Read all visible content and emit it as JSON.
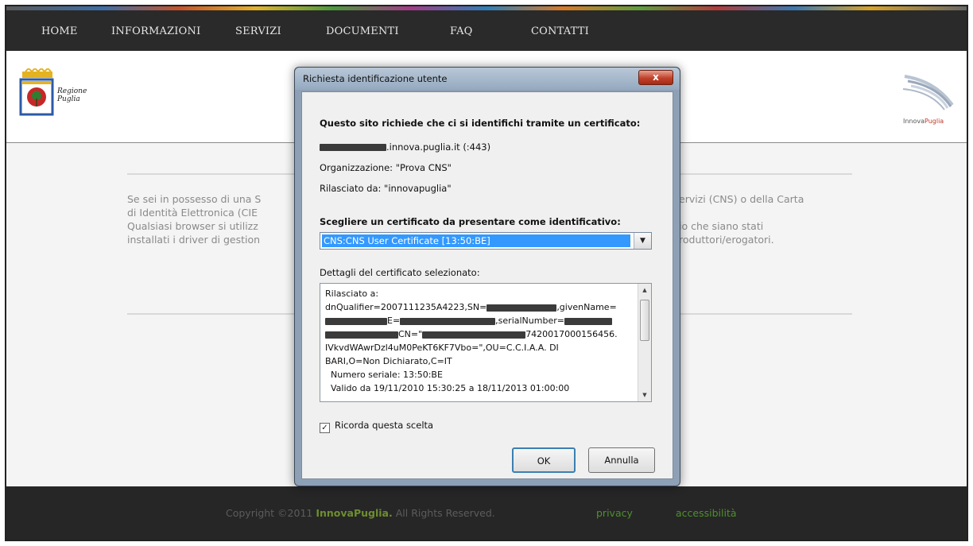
{
  "nav": {
    "items": [
      "HOME",
      "INFORMAZIONI",
      "SERVIZI",
      "DOCUMENTI",
      "FAQ",
      "CONTATTI"
    ]
  },
  "header": {
    "left_logo": {
      "line1": "Regione",
      "line2": "Puglia",
      "icon": "regione-puglia-coat-of-arms"
    },
    "right_logo": {
      "text_prefix": "Innova",
      "text_suffix": "Puglia",
      "icon": "innovapuglia-swoosh"
    }
  },
  "main": {
    "text_lines": [
      "Se sei in possesso di una S",
      "di Identità Elettronica (CIE",
      "Qualsiasi browser si utilizz",
      "installati i driver di gestion"
    ],
    "text_lines_right": [
      "ervizi (CNS) o della Carta",
      "",
      "io che siano stati",
      "roduttori/erogatori."
    ]
  },
  "footer": {
    "copyright_prefix": "Copyright ©2011",
    "brand": "InnovaPuglia.",
    "rights": "All Rights Reserved.",
    "privacy": "privacy",
    "accessibility": "accessibilità"
  },
  "dialog": {
    "title": "Richiesta identificazione utente",
    "close_label": "x",
    "intro": "Questo sito richiede che ci si identifichi tramite un certificato:",
    "site_suffix": ".innova.puglia.it (:443)",
    "organization": "Organizzazione: \"Prova CNS\"",
    "issued_by": "Rilasciato da: \"innovapuglia\"",
    "choose_label": "Scegliere un certificato da presentare come identificativo:",
    "selected_cert": "CNS:CNS User Certificate [13:50:BE]",
    "details_label": "Dettagli del certificato selezionato:",
    "details": {
      "line1": "Rilasciato a:",
      "line2a": "dnQualifier=2007111235A4223,SN=",
      "line2b": ",givenName=",
      "line3a": "E=",
      "line3b": ",serialNumber=",
      "line4a": "CN=\"",
      "line4b": "7420017000156456.",
      "line5": "IVkvdWAwrDzl4uM0PeKT6KF7Vbo=\",OU=C.C.I.A.A. DI",
      "line6": "BARI,O=Non Dichiarato,C=IT",
      "line7": "  Numero seriale: 13:50:BE",
      "line8": "  Valido da 19/11/2010 15:30:25 a 18/11/2013 01:00:00"
    },
    "remember_label": "Ricorda questa scelta",
    "remember_checked": "✓",
    "ok_label": "OK",
    "cancel_label": "Annulla"
  },
  "colors": {
    "nav_bg": "#2a2a2a",
    "footer_brand": "#6e8e2f",
    "footer_links": "#4f8f2f",
    "selection": "#3399ff"
  }
}
